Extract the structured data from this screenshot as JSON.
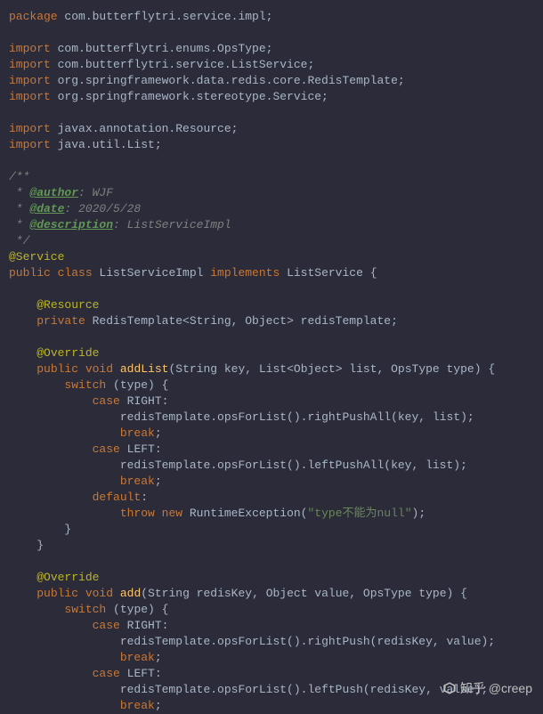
{
  "code": {
    "l1_kw": "package",
    "l1_rest": " com.butterflytri.service.impl;",
    "l2": "",
    "l3_kw": "import",
    "l3_rest": " com.butterflytri.enums.OpsType;",
    "l4_kw": "import",
    "l4_rest": " com.butterflytri.service.ListService;",
    "l5_kw": "import",
    "l5_rest": " org.springframework.data.redis.core.RedisTemplate;",
    "l6_kw": "import",
    "l6_rest": " org.springframework.stereotype.Service;",
    "l7": "",
    "l8_kw": "import",
    "l8_rest": " javax.annotation.Resource;",
    "l9_kw": "import",
    "l9_rest": " java.util.List;",
    "l10": "",
    "l11": "/**",
    "l12_pre": " * ",
    "l12_tag": "@author",
    "l12_post": ": WJF",
    "l13_pre": " * ",
    "l13_tag": "@date",
    "l13_post": ": 2020/5/28",
    "l14_pre": " * ",
    "l14_tag": "@description",
    "l14_post": ": ListServiceImpl",
    "l15": " */",
    "l16": "@Service",
    "l17_kw1": "public",
    "l17_kw2": " class",
    "l17_name": " ListServiceImpl ",
    "l17_kw3": "implements",
    "l17_iface": " ListService ",
    "l17_brace": "{",
    "l18": "",
    "l19_indent": "    ",
    "l19": "@Resource",
    "l20_indent": "    ",
    "l20_kw": "private",
    "l20_rest": " RedisTemplate<String, Object> redisTemplate;",
    "l21": "",
    "l22_indent": "    ",
    "l22": "@Override",
    "l23_indent": "    ",
    "l23_kw1": "public",
    "l23_kw2": " void",
    "l23_method": " addList",
    "l23_rest": "(String key, List<Object> list, OpsType type) {",
    "l24_indent": "        ",
    "l24_kw": "switch",
    "l24_rest": " (type) {",
    "l25_indent": "            ",
    "l25_kw": "case",
    "l25_rest": " RIGHT:",
    "l26_indent": "                ",
    "l26": "redisTemplate.opsForList().rightPushAll(key, list);",
    "l27_indent": "                ",
    "l27_kw": "break",
    "l27_rest": ";",
    "l28_indent": "            ",
    "l28_kw": "case",
    "l28_rest": " LEFT:",
    "l29_indent": "                ",
    "l29": "redisTemplate.opsForList().leftPushAll(key, list);",
    "l30_indent": "                ",
    "l30_kw": "break",
    "l30_rest": ";",
    "l31_indent": "            ",
    "l31_kw": "default",
    "l31_rest": ":",
    "l32_indent": "                ",
    "l32_kw1": "throw",
    "l32_kw2": " new",
    "l32_cls": " RuntimeException(",
    "l32_str": "\"type不能为null\"",
    "l32_end": ");",
    "l33": "        }",
    "l34": "    }",
    "l35": "",
    "l36_indent": "    ",
    "l36": "@Override",
    "l37_indent": "    ",
    "l37_kw1": "public",
    "l37_kw2": " void",
    "l37_method": " add",
    "l37_rest": "(String redisKey, Object value, OpsType type) {",
    "l38_indent": "        ",
    "l38_kw": "switch",
    "l38_rest": " (type) {",
    "l39_indent": "            ",
    "l39_kw": "case",
    "l39_rest": " RIGHT:",
    "l40_indent": "                ",
    "l40": "redisTemplate.opsForList().rightPush(redisKey, value);",
    "l41_indent": "                ",
    "l41_kw": "break",
    "l41_rest": ";",
    "l42_indent": "            ",
    "l42_kw": "case",
    "l42_rest": " LEFT:",
    "l43_indent": "                ",
    "l43": "redisTemplate.opsForList().leftPush(redisKey, value);",
    "l44_indent": "                ",
    "l44_kw": "break",
    "l44_rest": ";"
  },
  "watermark": {
    "text": "知乎 @creep"
  }
}
